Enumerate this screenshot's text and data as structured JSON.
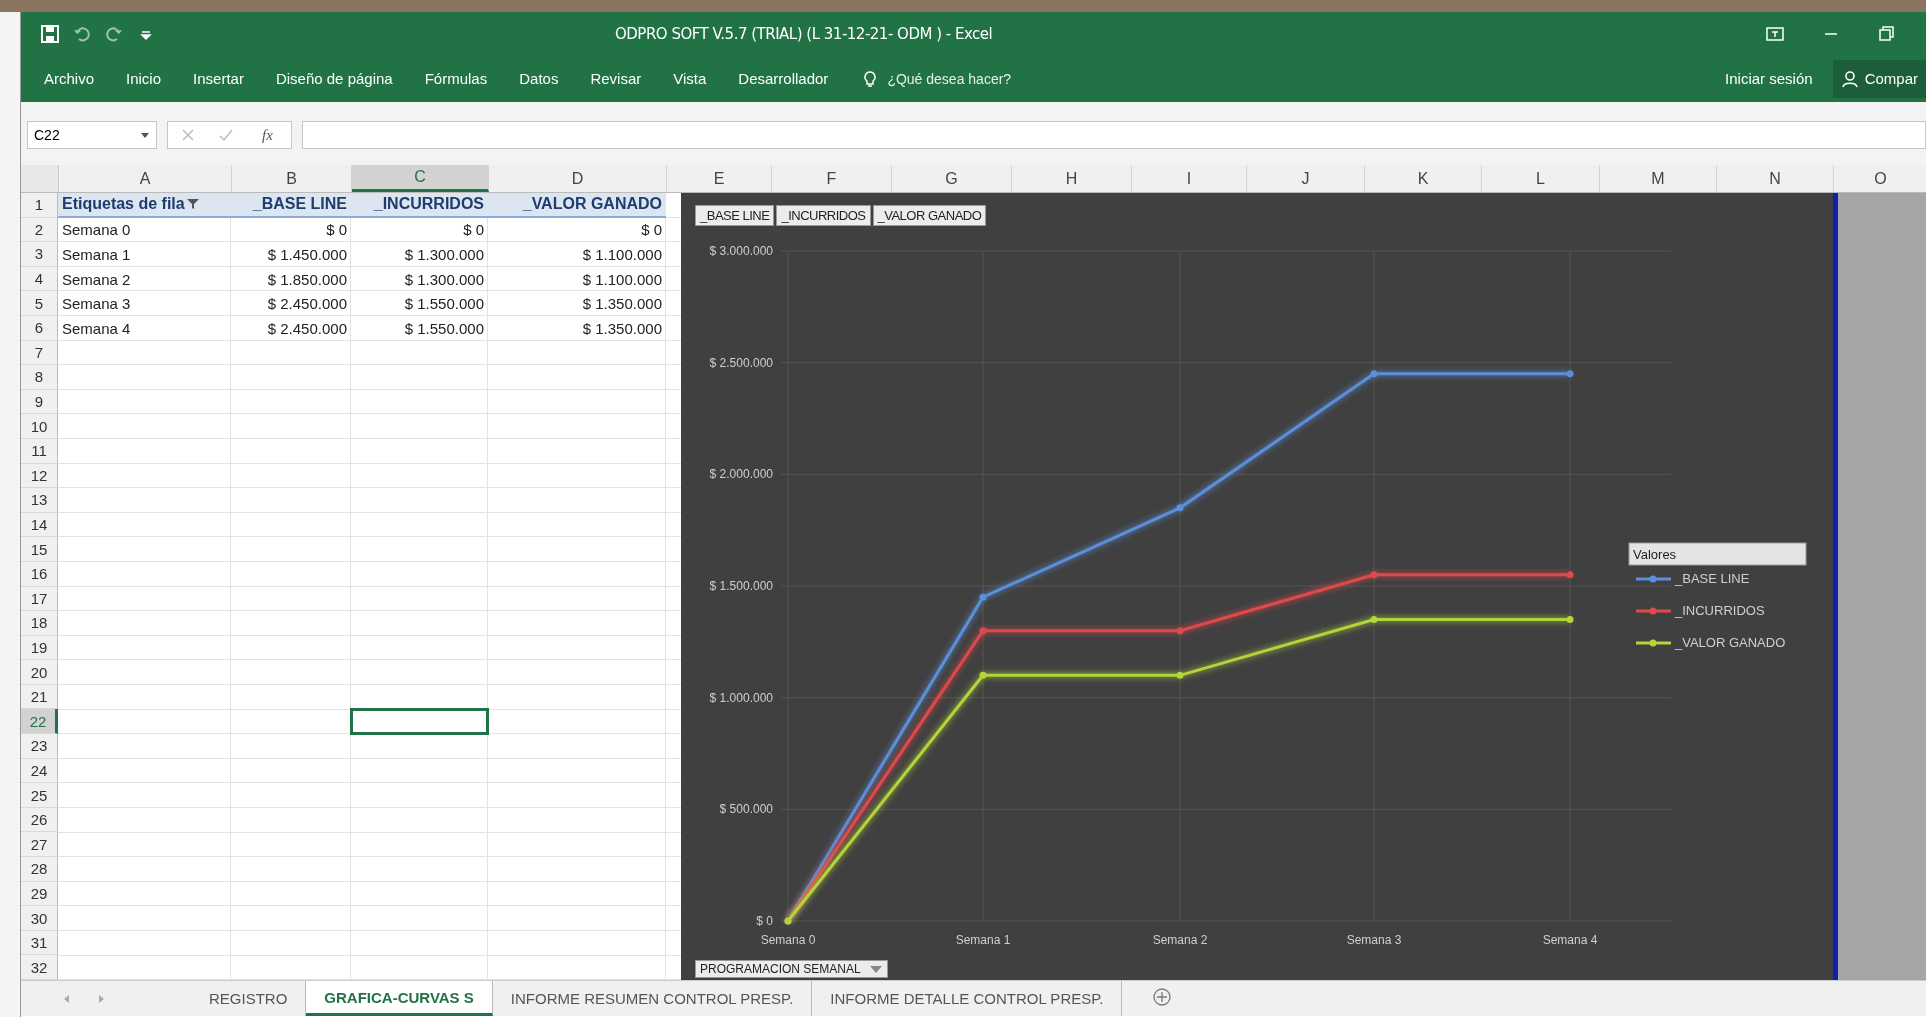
{
  "window": {
    "title": "ODPRO SOFT V.5.7 (TRIAL) (L 31-12-21- ODM ) - Excel"
  },
  "ribbon_tabs": [
    "Archivo",
    "Inicio",
    "Insertar",
    "Diseño de página",
    "Fórmulas",
    "Datos",
    "Revisar",
    "Vista",
    "Desarrollador"
  ],
  "tell_me": {
    "placeholder": "¿Qué desea hacer?"
  },
  "account": {
    "sign_in": "Iniciar sesión",
    "share": "Compar"
  },
  "name_box": {
    "value": "C22"
  },
  "formula_bar": {
    "fx": "fx"
  },
  "columns": [
    {
      "label": "A",
      "selected": false
    },
    {
      "label": "B",
      "selected": false
    },
    {
      "label": "C",
      "selected": true
    },
    {
      "label": "D",
      "selected": false
    },
    {
      "label": "E",
      "selected": false
    },
    {
      "label": "F",
      "selected": false
    },
    {
      "label": "G",
      "selected": false
    },
    {
      "label": "H",
      "selected": false
    },
    {
      "label": "I",
      "selected": false
    },
    {
      "label": "J",
      "selected": false
    },
    {
      "label": "K",
      "selected": false
    },
    {
      "label": "L",
      "selected": false
    },
    {
      "label": "M",
      "selected": false
    },
    {
      "label": "N",
      "selected": false
    },
    {
      "label": "O",
      "selected": false
    }
  ],
  "rows": [
    {
      "label": "1",
      "selected": false,
      "kind": "header",
      "cells": [
        "Etiquetas de fila",
        "_BASE LINE",
        "_INCURRIDOS",
        "_VALOR GANADO"
      ]
    },
    {
      "label": "2",
      "selected": false,
      "kind": "data",
      "cells": [
        "Semana 0",
        "$ 0",
        "$ 0",
        "$ 0"
      ]
    },
    {
      "label": "3",
      "selected": false,
      "kind": "data",
      "cells": [
        "Semana 1",
        "$ 1.450.000",
        "$ 1.300.000",
        "$ 1.100.000"
      ]
    },
    {
      "label": "4",
      "selected": false,
      "kind": "data",
      "cells": [
        "Semana 2",
        "$ 1.850.000",
        "$ 1.300.000",
        "$ 1.100.000"
      ]
    },
    {
      "label": "5",
      "selected": false,
      "kind": "data",
      "cells": [
        "Semana 3",
        "$ 2.450.000",
        "$ 1.550.000",
        "$ 1.350.000"
      ]
    },
    {
      "label": "6",
      "selected": false,
      "kind": "data",
      "cells": [
        "Semana 4",
        "$ 2.450.000",
        "$ 1.550.000",
        "$ 1.350.000"
      ]
    },
    {
      "label": "7",
      "selected": false
    },
    {
      "label": "8",
      "selected": false
    },
    {
      "label": "9",
      "selected": false
    },
    {
      "label": "10",
      "selected": false
    },
    {
      "label": "11",
      "selected": false
    },
    {
      "label": "12",
      "selected": false
    },
    {
      "label": "13",
      "selected": false
    },
    {
      "label": "14",
      "selected": false
    },
    {
      "label": "15",
      "selected": false
    },
    {
      "label": "16",
      "selected": false
    },
    {
      "label": "17",
      "selected": false
    },
    {
      "label": "18",
      "selected": false
    },
    {
      "label": "19",
      "selected": false
    },
    {
      "label": "20",
      "selected": false
    },
    {
      "label": "21",
      "selected": false
    },
    {
      "label": "22",
      "selected": true
    },
    {
      "label": "23",
      "selected": false
    },
    {
      "label": "24",
      "selected": false
    },
    {
      "label": "25",
      "selected": false
    },
    {
      "label": "26",
      "selected": false
    },
    {
      "label": "27",
      "selected": false
    },
    {
      "label": "28",
      "selected": false
    },
    {
      "label": "29",
      "selected": false
    },
    {
      "label": "30",
      "selected": false
    },
    {
      "label": "31",
      "selected": false
    },
    {
      "label": "32",
      "selected": false
    }
  ],
  "chart": {
    "field_buttons": [
      "_BASE LINE",
      "_INCURRIDOS",
      "_VALOR GANADO"
    ],
    "legend_title": "Valores",
    "axis_field_button": "PROGRAMACION SEMANAL",
    "chart_data": {
      "type": "line",
      "grid": true,
      "legend": true,
      "categories": [
        "Semana 0",
        "Semana 1",
        "Semana 2",
        "Semana 3",
        "Semana 4"
      ],
      "series": [
        {
          "name": "_BASE LINE",
          "color": "#5b8fd9",
          "marker": "circle",
          "values": [
            0,
            1450000,
            1850000,
            2450000,
            2450000
          ]
        },
        {
          "name": "_INCURRIDOS",
          "color": "#e0484c",
          "marker": "circle",
          "values": [
            0,
            1300000,
            1300000,
            1550000,
            1550000
          ]
        },
        {
          "name": "_VALOR GANADO",
          "color": "#b3d43a",
          "marker": "circle",
          "values": [
            0,
            1100000,
            1100000,
            1350000,
            1350000
          ]
        }
      ],
      "ylim": [
        0,
        3000000
      ],
      "yticks": [
        {
          "value": 0,
          "label": "$ 0"
        },
        {
          "value": 500000,
          "label": "$ 500.000"
        },
        {
          "value": 1000000,
          "label": "$ 1.000.000"
        },
        {
          "value": 1500000,
          "label": "$ 1.500.000"
        },
        {
          "value": 2000000,
          "label": "$ 2.000.000"
        },
        {
          "value": 2500000,
          "label": "$ 2.500.000"
        },
        {
          "value": 3000000,
          "label": "$ 3.000.000"
        }
      ]
    }
  },
  "sheet_tabs": [
    {
      "label": "REGISTRO",
      "selected": false
    },
    {
      "label": "GRAFICA-CURVAS S",
      "selected": true
    },
    {
      "label": "INFORME RESUMEN CONTROL PRESP.",
      "selected": false
    },
    {
      "label": "INFORME DETALLE CONTROL PRESP.",
      "selected": false
    }
  ]
}
